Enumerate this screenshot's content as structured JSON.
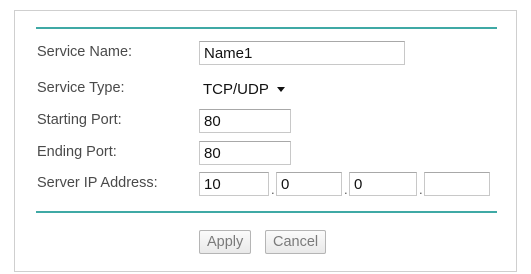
{
  "form": {
    "service_name": {
      "label": "Service Name:",
      "value": "Name1"
    },
    "service_type": {
      "label": "Service Type:",
      "selected": "TCP/UDP"
    },
    "starting_port": {
      "label": "Starting Port:",
      "value": "80"
    },
    "ending_port": {
      "label": "Ending Port:",
      "value": "80"
    },
    "server_ip": {
      "label": "Server IP Address:",
      "octets": [
        "10",
        "0",
        "0",
        ""
      ],
      "separator": "."
    }
  },
  "buttons": {
    "apply": "Apply",
    "cancel": "Cancel"
  },
  "colors": {
    "accent_rule": "#3fa9a5",
    "panel_border": "#cfcfcf"
  },
  "icons": {
    "dropdown": "chevron-down-icon"
  }
}
